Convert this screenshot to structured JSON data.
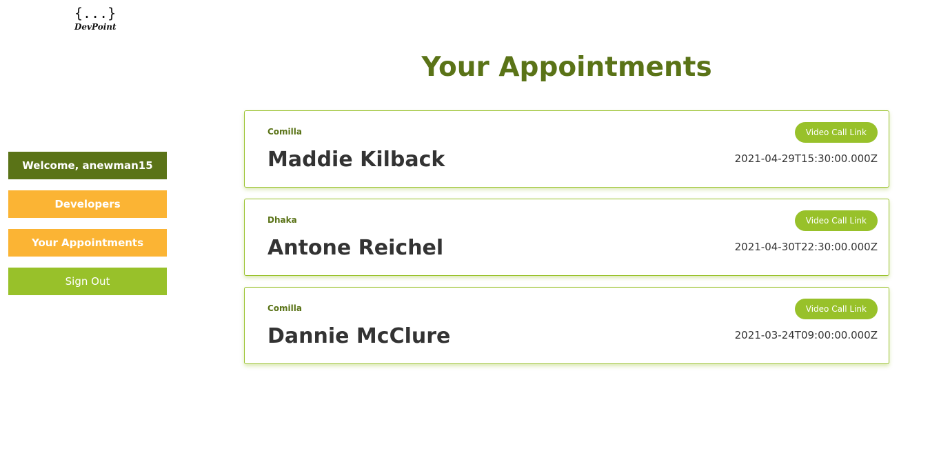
{
  "logo": {
    "braces": "{...}",
    "text": "DevPoint"
  },
  "sidebar": {
    "items": [
      {
        "label": "Welcome, anewman15"
      },
      {
        "label": "Developers"
      },
      {
        "label": "Your Appointments"
      },
      {
        "label": "Sign Out"
      }
    ]
  },
  "main": {
    "title": "Your Appointments",
    "appointments": [
      {
        "location": "Comilla",
        "name": "Maddie Kilback",
        "link_label": "Video Call Link",
        "datetime": "2021-04-29T15:30:00.000Z"
      },
      {
        "location": "Dhaka",
        "name": "Antone Reichel",
        "link_label": "Video Call Link",
        "datetime": "2021-04-30T22:30:00.000Z"
      },
      {
        "location": "Comilla",
        "name": "Dannie McClure",
        "link_label": "Video Call Link",
        "datetime": "2021-03-24T09:00:00.000Z"
      }
    ]
  },
  "colors": {
    "primary_green": "#5a7317",
    "light_green": "#98c12a",
    "orange": "#fbb434",
    "text": "#333333"
  }
}
